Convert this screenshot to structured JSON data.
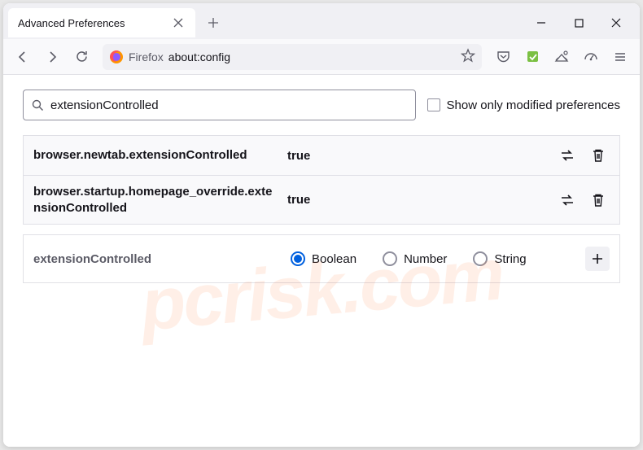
{
  "tab": {
    "title": "Advanced Preferences"
  },
  "urlbar": {
    "label": "Firefox",
    "url": "about:config"
  },
  "search": {
    "value": "extensionControlled",
    "checkbox_label": "Show only modified preferences"
  },
  "prefs": [
    {
      "name": "browser.newtab.extensionControlled",
      "value": "true"
    },
    {
      "name": "browser.startup.homepage_override.extensionControlled",
      "value": "true"
    }
  ],
  "new_pref": {
    "name": "extensionControlled",
    "types": [
      {
        "label": "Boolean",
        "checked": true
      },
      {
        "label": "Number",
        "checked": false
      },
      {
        "label": "String",
        "checked": false
      }
    ]
  },
  "watermark": "pcrisk.com"
}
